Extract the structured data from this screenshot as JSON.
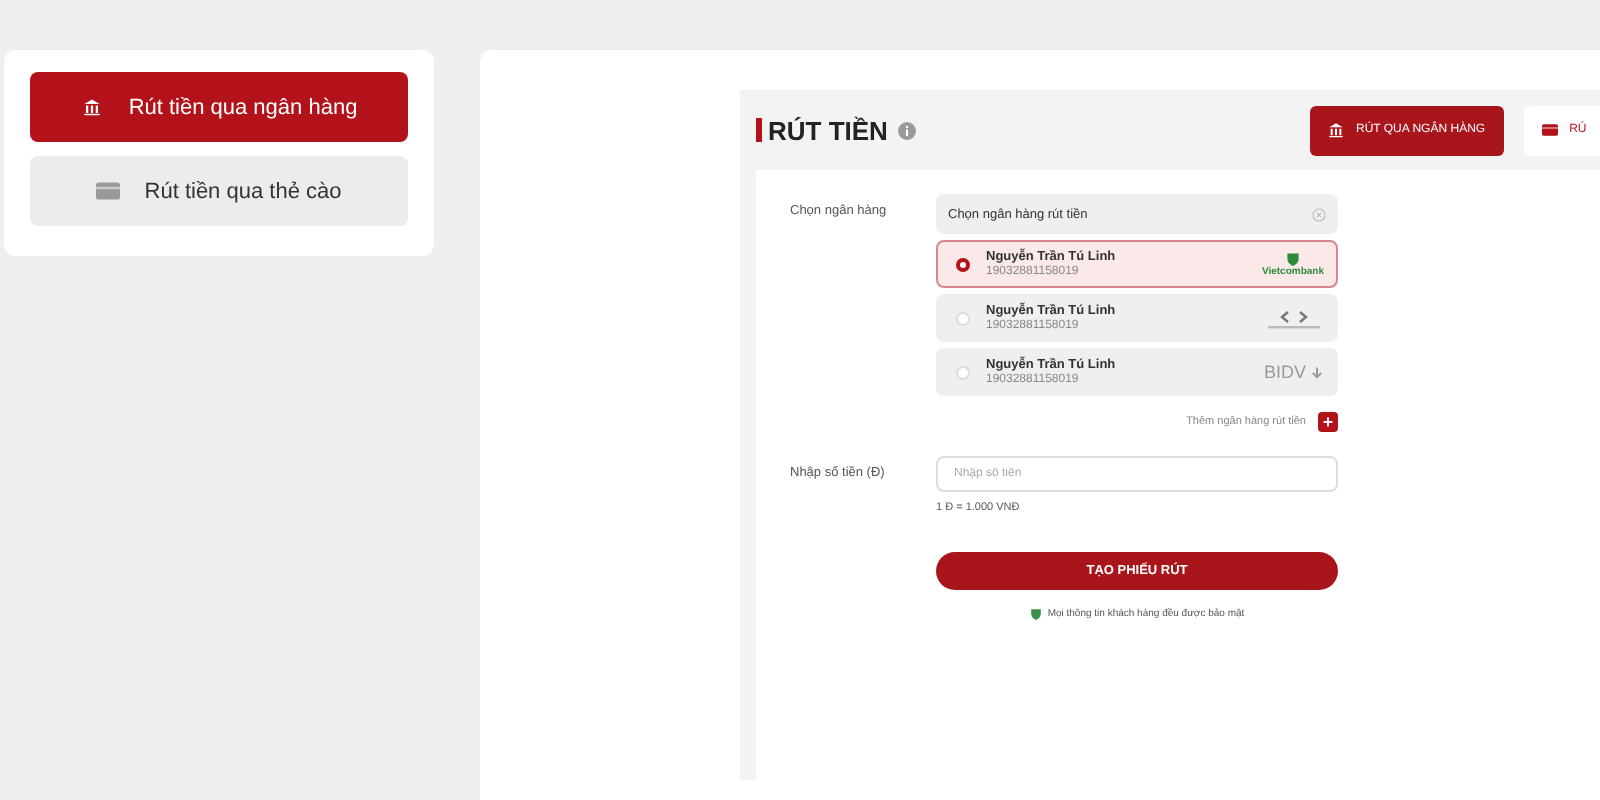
{
  "sidebar": {
    "items": [
      {
        "label": "Rút tiền qua ngân hàng",
        "selected": true,
        "kind": "bank"
      },
      {
        "label": "Rút tiền qua thẻ cào",
        "selected": false,
        "kind": "card"
      }
    ]
  },
  "panel": {
    "title": "RÚT TIỀN",
    "tabs": [
      {
        "label": "RÚT QUA NGÂN HÀNG",
        "selected": true,
        "kind": "bank"
      },
      {
        "label": "RÚ",
        "selected": false,
        "kind": "card"
      }
    ],
    "bank_label": "Chọn ngân hàng",
    "bank_select": {
      "placeholder": "Chọn ngân hàng rút tiền"
    },
    "accounts": [
      {
        "name": "Nguyễn Trần Tú Linh",
        "number": "19032881158019",
        "selected": true,
        "kind": "shield",
        "logo_text": "Vietcombank"
      },
      {
        "name": "Nguyễn Trần Tú Linh",
        "number": "19032881158019",
        "selected": false,
        "kind": "brackets"
      },
      {
        "name": "Nguyễn Trần Tú Linh",
        "number": "19032881158019",
        "selected": false,
        "kind": "arrow",
        "logo_text": "BIDV"
      }
    ],
    "add_bank": "Thêm ngân hàng rút tiền",
    "amount_label": "Nhập số tiền (Đ)",
    "amount_field": {
      "placeholder": "Nhập số tiền"
    },
    "rate": "1 Đ = 1.000 VNĐ",
    "submit": "TẠO PHIẾU RÚT",
    "security_note": "Mọi thông tin khách hàng đều được bảo mật"
  }
}
